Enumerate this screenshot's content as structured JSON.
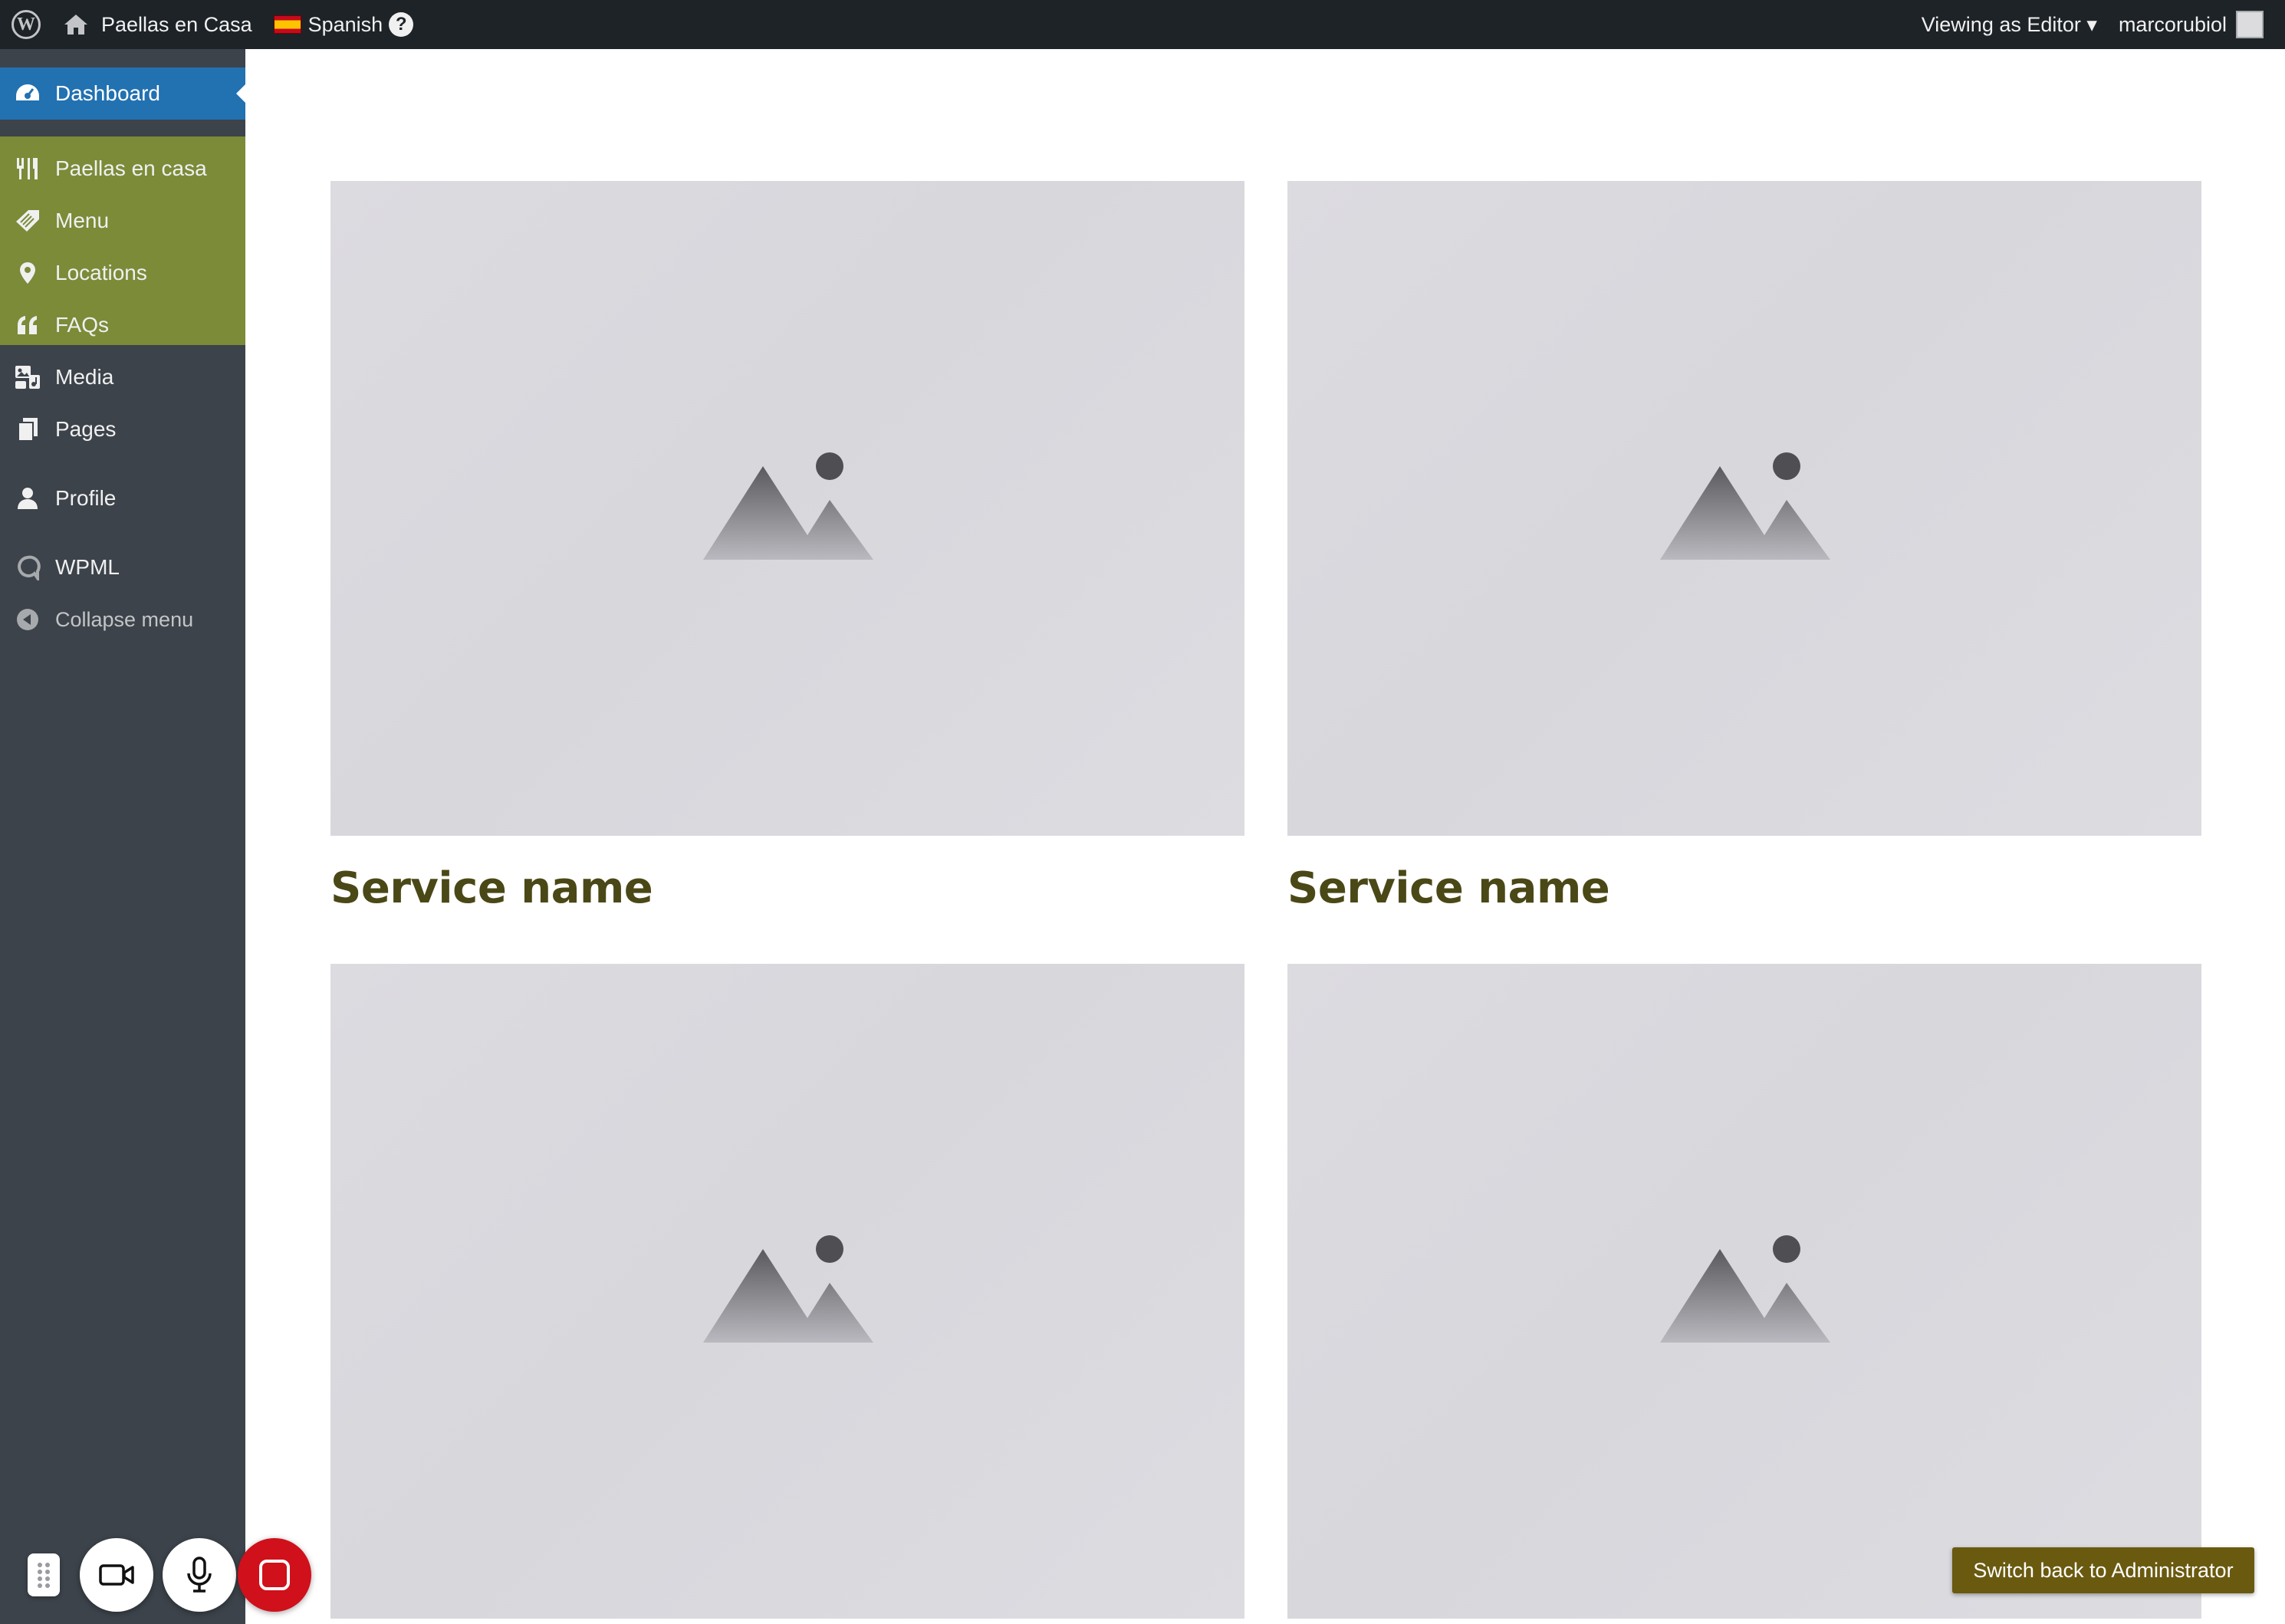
{
  "adminbar": {
    "site_name": "Paellas en Casa",
    "language": "Spanish",
    "help_label": "?",
    "viewing_as": "Viewing as Editor ▾",
    "username": "marcorubiol"
  },
  "sidebar": {
    "items": [
      {
        "label": "Dashboard",
        "icon": "dashboard-icon"
      },
      {
        "label": "Paellas en casa",
        "icon": "fork-knife-icon"
      },
      {
        "label": "Menu",
        "icon": "tag-icon"
      },
      {
        "label": "Locations",
        "icon": "location-pin-icon"
      },
      {
        "label": "FAQs",
        "icon": "quote-icon"
      },
      {
        "label": "Media",
        "icon": "media-icon"
      },
      {
        "label": "Pages",
        "icon": "pages-icon"
      },
      {
        "label": "Profile",
        "icon": "user-icon"
      },
      {
        "label": "WPML",
        "icon": "wpml-icon"
      },
      {
        "label": "Collapse menu",
        "icon": "collapse-icon"
      }
    ]
  },
  "main": {
    "services": [
      {
        "title": "Service name"
      },
      {
        "title": "Service name"
      },
      {
        "title": ""
      },
      {
        "title": ""
      }
    ]
  },
  "recorder": {
    "icons": [
      "drag-handle-icon",
      "camera-icon",
      "microphone-icon",
      "stop-icon"
    ]
  },
  "switch_back": "Switch back to Administrator",
  "colors": {
    "adminbar_bg": "#1d2327",
    "sidebar_bg": "#3c434a",
    "active_item_bg": "#2271b1",
    "highlight_group_bg": "#7b8b38",
    "service_title": "#4a4816",
    "switch_button_bg": "#6a5a10",
    "stop_button": "#d0101b"
  }
}
